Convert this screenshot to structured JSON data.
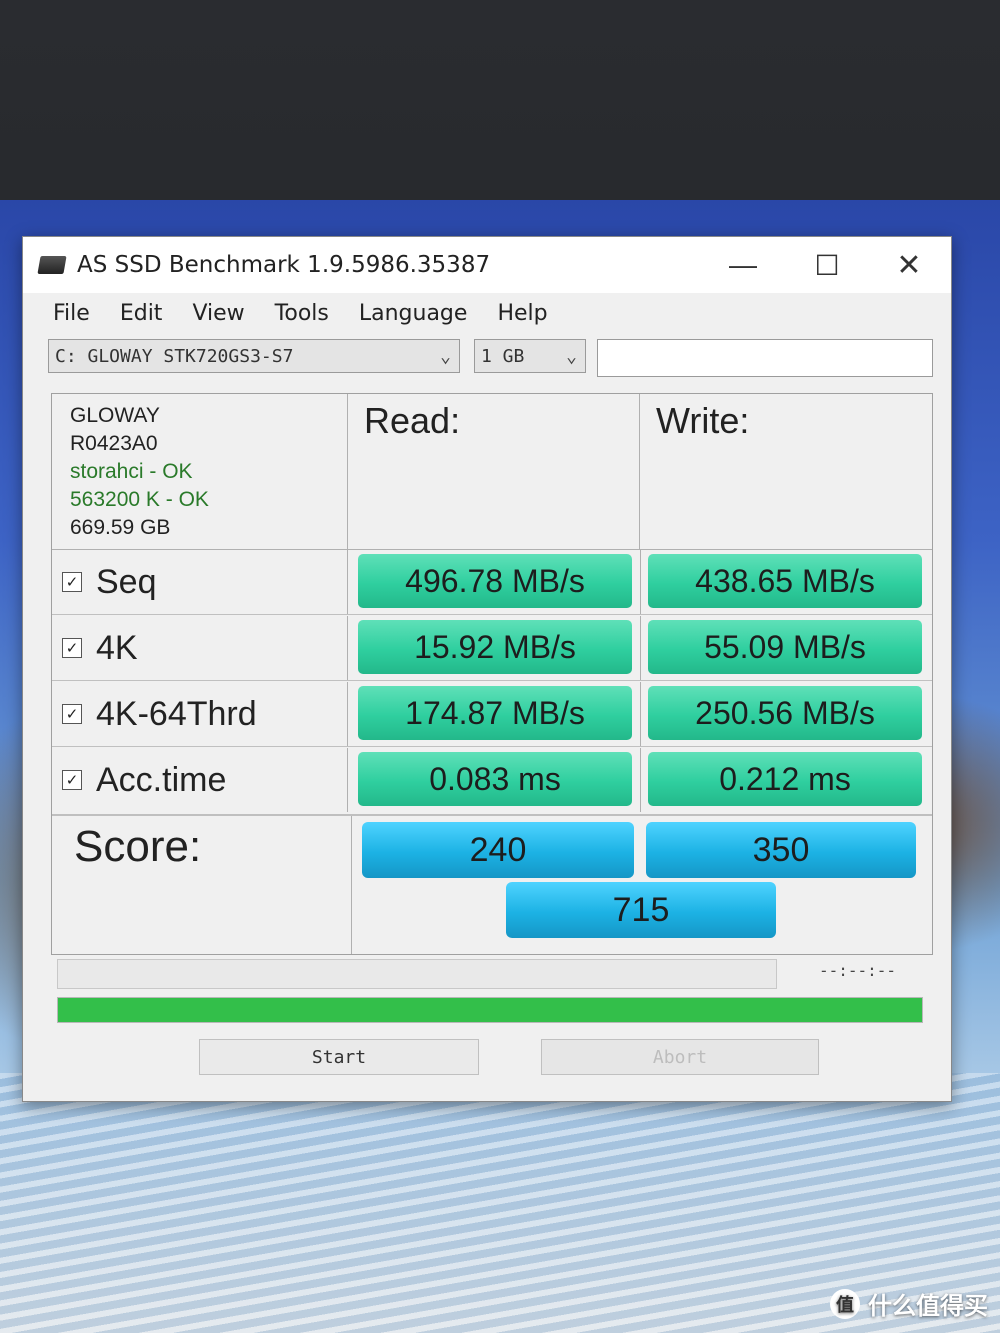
{
  "window": {
    "title": "AS SSD Benchmark 1.9.5986.35387",
    "controls": {
      "minimize": "—",
      "maximize": "☐",
      "close": "✕"
    }
  },
  "menu": [
    "File",
    "Edit",
    "View",
    "Tools",
    "Language",
    "Help"
  ],
  "toolbar": {
    "drive": "C: GLOWAY STK720GS3-S7",
    "size": "1 GB",
    "status": ""
  },
  "info": {
    "model": "GLOWAY",
    "firmware": "R0423A0",
    "driver": "storahci - OK",
    "alignment": "563200 K - OK",
    "capacity": "669.59 GB"
  },
  "headers": {
    "read": "Read:",
    "write": "Write:"
  },
  "rows": [
    {
      "label": "Seq",
      "checked": true,
      "read": "496.78 MB/s",
      "write": "438.65 MB/s"
    },
    {
      "label": "4K",
      "checked": true,
      "read": "15.92 MB/s",
      "write": "55.09 MB/s"
    },
    {
      "label": "4K-64Thrd",
      "checked": true,
      "read": "174.87 MB/s",
      "write": "250.56 MB/s"
    },
    {
      "label": "Acc.time",
      "checked": true,
      "read": "0.083 ms",
      "write": "0.212 ms"
    }
  ],
  "score": {
    "label": "Score:",
    "read": "240",
    "write": "350",
    "total": "715"
  },
  "progress": {
    "time": "--:--:--",
    "main_fraction": 1.0
  },
  "buttons": {
    "start": "Start",
    "abort": "Abort"
  },
  "watermark": {
    "text": "什么值得买",
    "logo": "值"
  },
  "colors": {
    "result_green": "#2fcf9f",
    "score_blue": "#1cb2e4",
    "progress_green": "#33bf4a"
  }
}
